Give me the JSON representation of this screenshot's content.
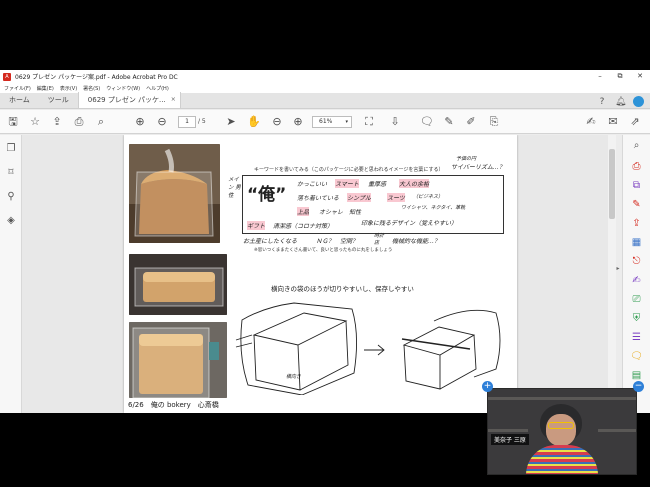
{
  "window": {
    "title": "0629 プレゼン パッケージ案.pdf - Adobe Acrobat Pro DC",
    "controls": [
      "–",
      "⧉",
      "✕"
    ]
  },
  "menu": [
    "ファイル(F)",
    "編集(E)",
    "表示(V)",
    "署名(S)",
    "ウィンドウ(W)",
    "ヘルプ(H)"
  ],
  "tabs": {
    "home": "ホーム",
    "tools": "ツール",
    "document": "0629 プレゼン パッケ...",
    "close": "×"
  },
  "toolbar": {
    "page_current": "1",
    "page_total": "/ 5",
    "zoom": "61%"
  },
  "page": {
    "keyword_heading": "キーワードを書いてみる（このパッケージに必要と思われるイメージを言葉にする）",
    "cyber_note": "サイバーリズム…？",
    "note_top_right": "予価の円",
    "ore": "“俺”",
    "side_note": "メイン 男性",
    "keywords": [
      "かっこいい",
      "スマート",
      "重厚感",
      "大人の余裕",
      "落ち着いている",
      "シンプル",
      "スーツ",
      "（ビジネス）",
      "上品",
      "オシャレ",
      "知性",
      "ワイシャツ、ネクタイ、革靴",
      "ギフト",
      "清潔感（コロナ対策）",
      "印象に残るデザイン（覚えやすい）",
      "お土産にしたくなる",
      "ＮＧ？",
      "空間？",
      "時計 店",
      "機械的な機能…？"
    ],
    "footnote": "※思いつくままたくさん書いて、良いと思ったものに丸をしましょう",
    "sketch_caption": "横向きの袋のほうが切りやすいし、保存しやすい",
    "sketch_label": "横向き",
    "footer": "6/26　俺の bokery　心斎橋"
  },
  "video": {
    "name": "美奈子 三原"
  },
  "colors": {
    "accent": "#1a73c9",
    "highlight": "#f7b0be",
    "acrobat_red": "#d4291e"
  }
}
